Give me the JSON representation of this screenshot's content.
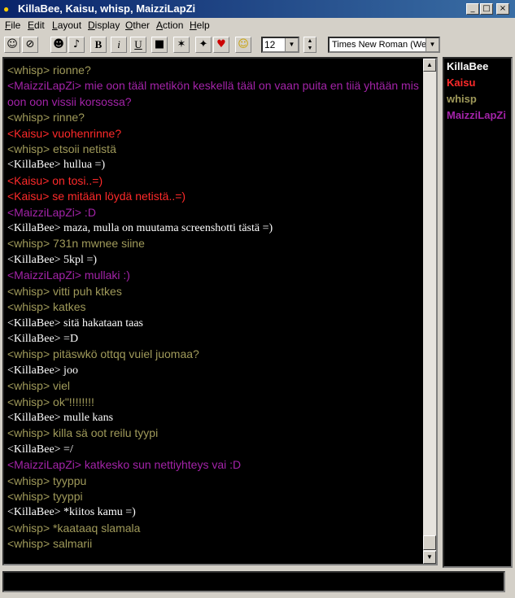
{
  "window": {
    "title": "KillaBee, Kaisu, whisp, MaizziLapZi"
  },
  "menu": [
    "File",
    "Edit",
    "Layout",
    "Display",
    "Other",
    "Action",
    "Help"
  ],
  "menu_underline": [
    "F",
    "E",
    "L",
    "D",
    "O",
    "A",
    "H"
  ],
  "toolbar": {
    "font_size": "12",
    "font_name": "Times New Roman (Wes"
  },
  "colors": {
    "KillaBee": "#ffffff",
    "Kaisu": "#ff2a2a",
    "whisp": "#a09a5a",
    "MaizziLapZi": "#a323a8"
  },
  "messages": [
    {
      "nick": "whisp",
      "text": "<whisp> rionne?"
    },
    {
      "nick": "MaizziLapZi",
      "text": "<MaizziLapZi> mie oon tääl metikön keskellä tääl on vaan puita en tiiä yhtään mis oon oon vissii korsossa?"
    },
    {
      "nick": "whisp",
      "text": "<whisp> rinne?"
    },
    {
      "nick": "Kaisu",
      "text": "<Kaisu> vuohenrinne?"
    },
    {
      "nick": "whisp",
      "text": "<whisp> etsoii netistä"
    },
    {
      "nick": "KillaBee",
      "text": "<KillaBee> hullua =)"
    },
    {
      "nick": "Kaisu",
      "text": "<Kaisu> on tosi..=)"
    },
    {
      "nick": "Kaisu",
      "text": "<Kaisu> se mitään löydä netistä..=)"
    },
    {
      "nick": "MaizziLapZi",
      "text": "<MaizziLapZi> :D"
    },
    {
      "nick": "KillaBee",
      "text": "<KillaBee> maza, mulla on muutama screenshotti tästä =)"
    },
    {
      "nick": "whisp",
      "text": "<whisp> 731n mwnee siine"
    },
    {
      "nick": "KillaBee",
      "text": "<KillaBee> 5kpl =)"
    },
    {
      "nick": "MaizziLapZi",
      "text": "<MaizziLapZi> mullaki :)"
    },
    {
      "nick": "whisp",
      "text": "<whisp> vitti puh ktkes"
    },
    {
      "nick": "whisp",
      "text": "<whisp> katkes"
    },
    {
      "nick": "KillaBee",
      "text": "<KillaBee> sitä hakataan taas"
    },
    {
      "nick": "KillaBee",
      "text": "<KillaBee> =D"
    },
    {
      "nick": "whisp",
      "text": "<whisp> pitäswkö ottqq vuiel juomaa?"
    },
    {
      "nick": "KillaBee",
      "text": "<KillaBee> joo"
    },
    {
      "nick": "whisp",
      "text": "<whisp> viel"
    },
    {
      "nick": "whisp",
      "text": "<whisp> ok\"!!!!!!!!"
    },
    {
      "nick": "KillaBee",
      "text": "<KillaBee> mulle kans"
    },
    {
      "nick": "whisp",
      "text": "<whisp> killa sä oot reilu tyypi"
    },
    {
      "nick": "KillaBee",
      "text": "<KillaBee> =/"
    },
    {
      "nick": "MaizziLapZi",
      "text": "<MaizziLapZi> katkesko sun nettiyhteys vai :D"
    },
    {
      "nick": "whisp",
      "text": "<whisp> tyyppu"
    },
    {
      "nick": "whisp",
      "text": "<whisp> tyyppi"
    },
    {
      "nick": "KillaBee",
      "text": "<KillaBee> *kiitos kamu =)"
    },
    {
      "nick": "whisp",
      "text": "<whisp> *kaataaq slamala"
    },
    {
      "nick": "whisp",
      "text": "<whisp> salmarii"
    }
  ],
  "users": [
    {
      "name": "KillaBee",
      "color": "#ffffff"
    },
    {
      "name": "Kaisu",
      "color": "#ff2a2a"
    },
    {
      "name": "whisp",
      "color": "#a09a5a"
    },
    {
      "name": "MaizziLapZi",
      "color": "#a323a8"
    }
  ],
  "input": {
    "value": ""
  }
}
